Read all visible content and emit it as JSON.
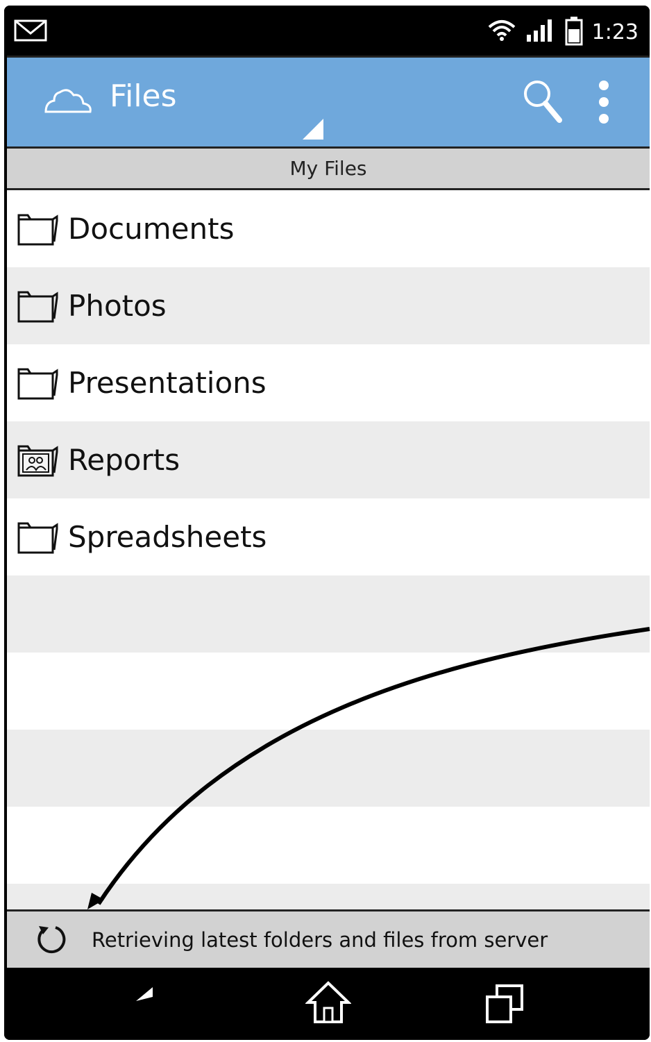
{
  "status_bar": {
    "time": "1:23",
    "icons": [
      "mail-icon",
      "wifi-icon",
      "signal-icon",
      "battery-icon"
    ]
  },
  "action_bar": {
    "title": "Files",
    "icons": [
      "cloud-icon",
      "search-icon",
      "overflow-menu-icon"
    ],
    "color": "#6fa8dc"
  },
  "breadcrumb": {
    "label": "My Files"
  },
  "folders": [
    {
      "name": "Documents",
      "icon": "folder-icon"
    },
    {
      "name": "Photos",
      "icon": "folder-icon"
    },
    {
      "name": "Presentations",
      "icon": "folder-icon"
    },
    {
      "name": "Reports",
      "icon": "shared-folder-icon"
    },
    {
      "name": "Spreadsheets",
      "icon": "folder-icon"
    }
  ],
  "bottom_status": {
    "text": "Retrieving latest folders and files from server",
    "icon": "refresh-icon"
  },
  "nav_bar": {
    "icons": [
      "back-icon",
      "home-icon",
      "recent-apps-icon"
    ]
  }
}
